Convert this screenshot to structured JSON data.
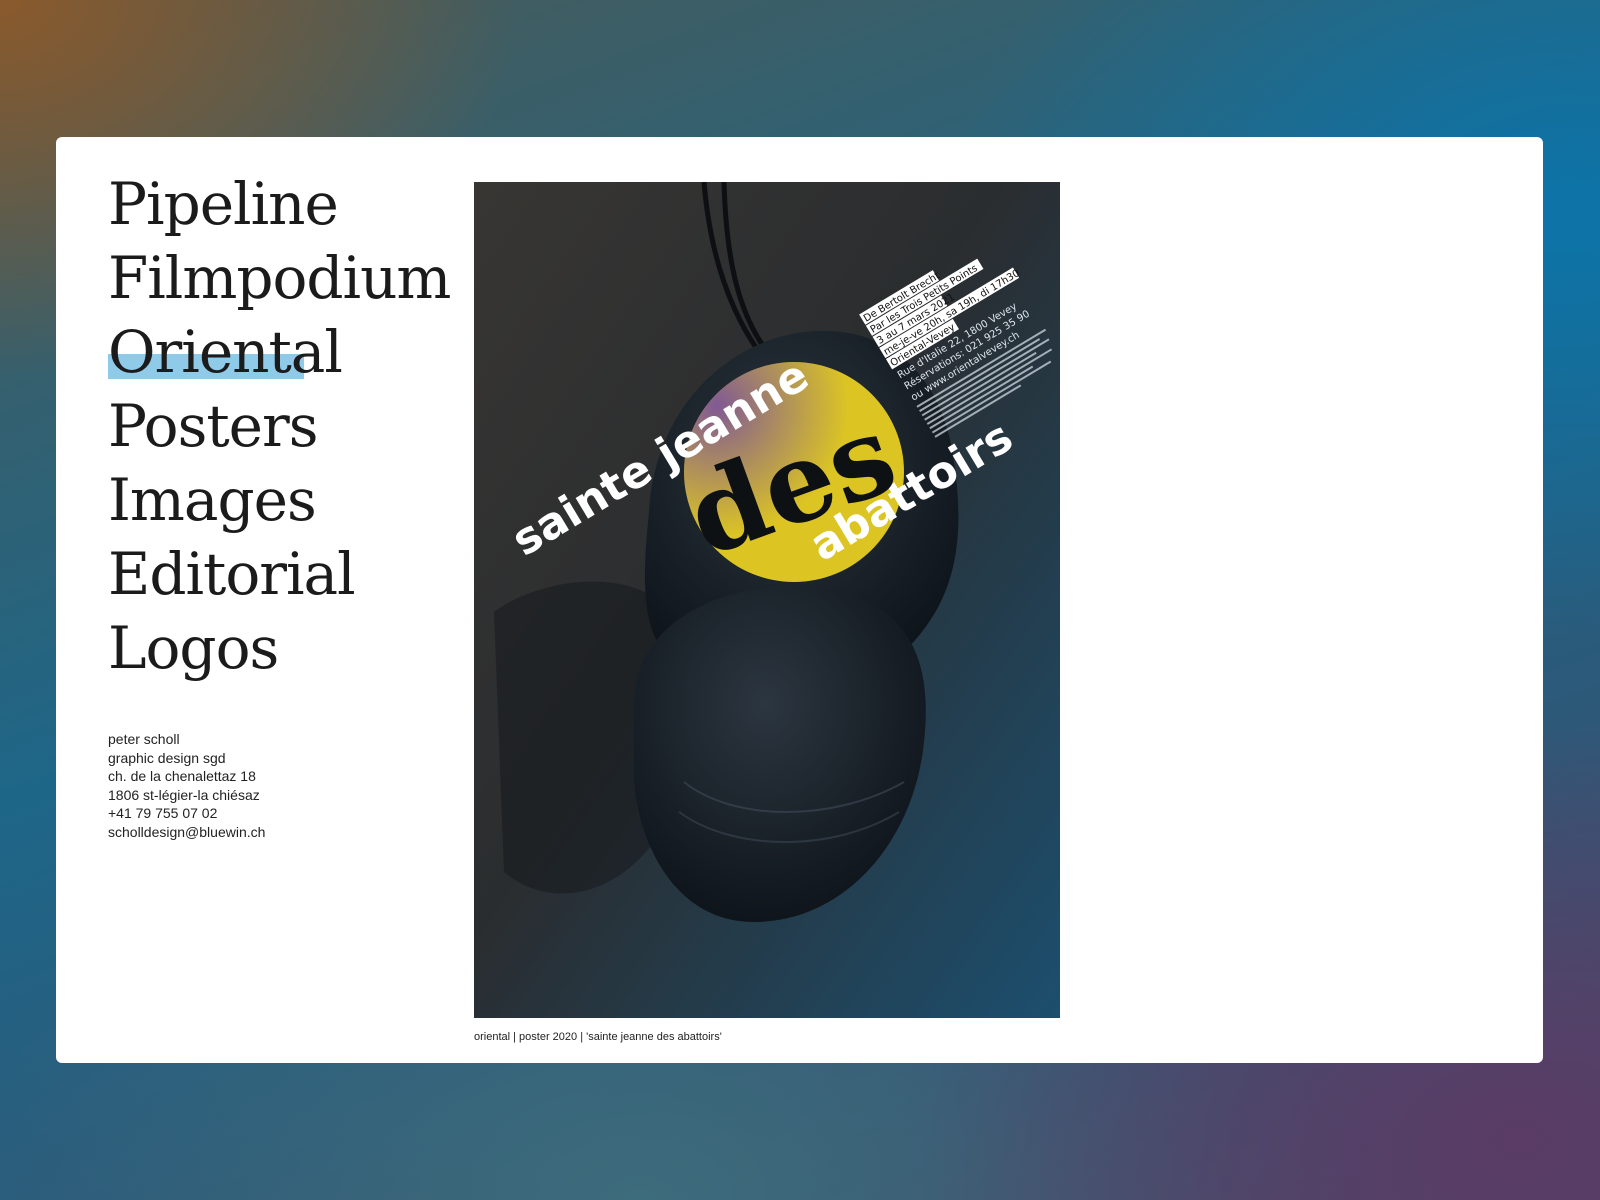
{
  "nav": {
    "items": [
      {
        "label": "Pipeline"
      },
      {
        "label": "Filmpodium"
      },
      {
        "label": "Oriental",
        "active": true
      },
      {
        "label": "Posters"
      },
      {
        "label": "Images"
      },
      {
        "label": "Editorial"
      },
      {
        "label": "Logos"
      }
    ]
  },
  "contact": {
    "lines": [
      "peter scholl",
      "graphic design sgd",
      "ch. de la chenalettaz 18",
      "1806 st-légier-la chiésaz",
      "+41 79 755 07 02",
      "scholldesign@bluewin.ch"
    ]
  },
  "poster": {
    "title_words": [
      "sainte jeanne",
      "des",
      "abattoirs"
    ],
    "info_highlight": [
      "De Bertolt Brecht",
      "Par les Trois Petits Points",
      "3 au 7 mars 2021",
      "me-je-ve 20h, sa 19h, di 17h30",
      "Oriental-Vevey"
    ],
    "info_plain": [
      "Rue d'Italie 22, 1800 Vevey",
      "Réservations: 021 925 35 90",
      "ou www.orientalvevey.ch"
    ],
    "colors": {
      "accent_yellow": "#dcc523",
      "highlight_blue": "#8fcae8"
    }
  },
  "caption": "oriental | poster 2020 | 'sainte jeanne des abattoirs'"
}
